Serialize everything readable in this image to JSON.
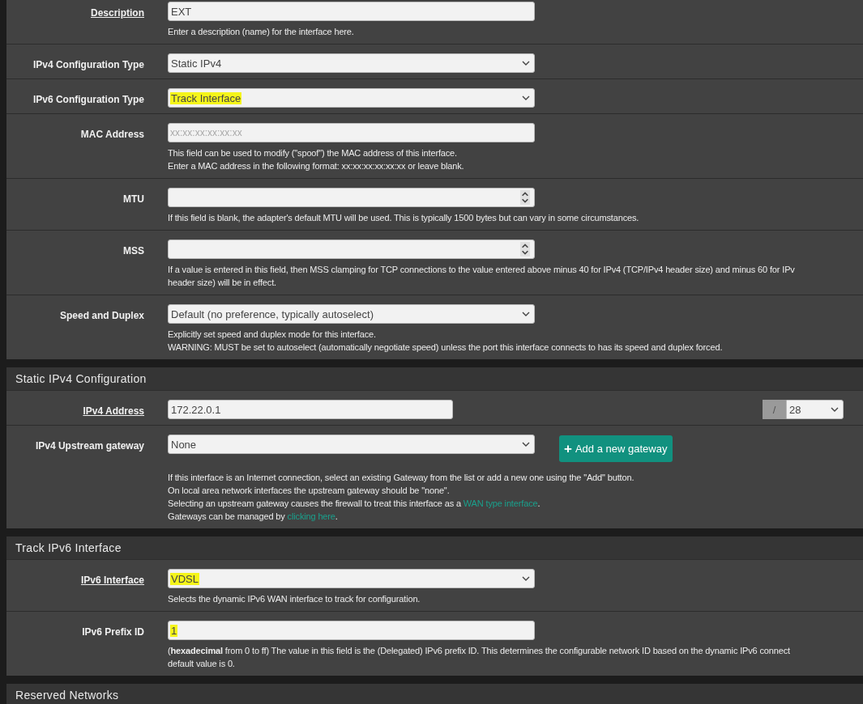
{
  "sections": [
    {
      "rows": [
        {
          "label": "Description",
          "label_link": true,
          "control": {
            "kind": "text",
            "value": "EXT"
          },
          "help": [
            "Enter a description (name) for the interface here."
          ]
        },
        {
          "label": "IPv4 Configuration Type",
          "label_link": false,
          "control": {
            "kind": "select",
            "value": "Static IPv4"
          }
        },
        {
          "label": "IPv6 Configuration Type",
          "label_link": false,
          "control": {
            "kind": "select",
            "value": "Track Interface",
            "highlighted": true
          }
        },
        {
          "label": "MAC Address",
          "label_link": false,
          "control": {
            "kind": "text",
            "placeholder": "xx:xx:xx:xx:xx:xx"
          },
          "help": [
            "This field can be used to modify (\"spoof\") the MAC address of this interface.",
            "Enter a MAC address in the following format: xx:xx:xx:xx:xx:xx or leave blank."
          ]
        },
        {
          "label": "MTU",
          "label_link": false,
          "control": {
            "kind": "number"
          },
          "help": [
            "If this field is blank, the adapter's default MTU will be used. This is typically 1500 bytes but can vary in some circumstances."
          ]
        },
        {
          "label": "MSS",
          "label_link": false,
          "control": {
            "kind": "number"
          },
          "help": [
            "If a value is entered in this field, then MSS clamping for TCP connections to the value entered above minus 40 for IPv4 (TCP/IPv4 header size) and minus 60 for IPv",
            "header size) will be in effect."
          ]
        },
        {
          "label": "Speed and Duplex",
          "label_link": false,
          "control": {
            "kind": "select",
            "value": "Default (no preference, typically autoselect)"
          },
          "help": [
            "Explicitly set speed and duplex mode for this interface.",
            "WARNING: MUST be set to autoselect (automatically negotiate speed) unless the port this interface connects to has its speed and duplex forced."
          ]
        }
      ]
    },
    {
      "title": "Static IPv4 Configuration",
      "rows": [
        {
          "label": "IPv4 Address",
          "label_link": true,
          "control": {
            "kind": "cidr",
            "value": "172.22.0.1",
            "separator": "/",
            "mask": "28"
          }
        },
        {
          "label": "IPv4 Upstream gateway",
          "label_link": false,
          "control": {
            "kind": "select",
            "value": "None"
          },
          "button": {
            "icon": "+",
            "label": "Add a new gateway"
          },
          "help": [
            "If this interface is an Internet connection, select an existing Gateway from the list or add a new one using the \"Add\" button.",
            "On local area network interfaces the upstream gateway should be \"none\".",
            [
              {
                "text": "Selecting an upstream gateway causes the firewall to treat this interface as a ",
                "kind": "plain"
              },
              {
                "text": "WAN type interface",
                "kind": "link"
              },
              {
                "text": ".",
                "kind": "plain"
              }
            ],
            [
              {
                "text": "Gateways can be managed by ",
                "kind": "plain"
              },
              {
                "text": "clicking here",
                "kind": "link"
              },
              {
                "text": ".",
                "kind": "plain"
              }
            ]
          ]
        }
      ]
    },
    {
      "title": "Track IPv6 Interface",
      "rows": [
        {
          "label": "IPv6 Interface",
          "label_link": true,
          "control": {
            "kind": "select",
            "value": "VDSL",
            "highlighted": true
          },
          "help": [
            "Selects the dynamic IPv6 WAN interface to track for configuration."
          ]
        },
        {
          "label": "IPv6 Prefix ID",
          "label_link": false,
          "control": {
            "kind": "text",
            "value": "1",
            "highlighted": true
          },
          "help": [
            "(**hexadecimal** from 0 to ff) The value in this field is the (Delegated) IPv6 prefix ID. This determines the configurable network ID based on the dynamic IPv6 connect",
            "default value is 0."
          ]
        }
      ]
    },
    {
      "title": "Reserved Networks"
    }
  ]
}
